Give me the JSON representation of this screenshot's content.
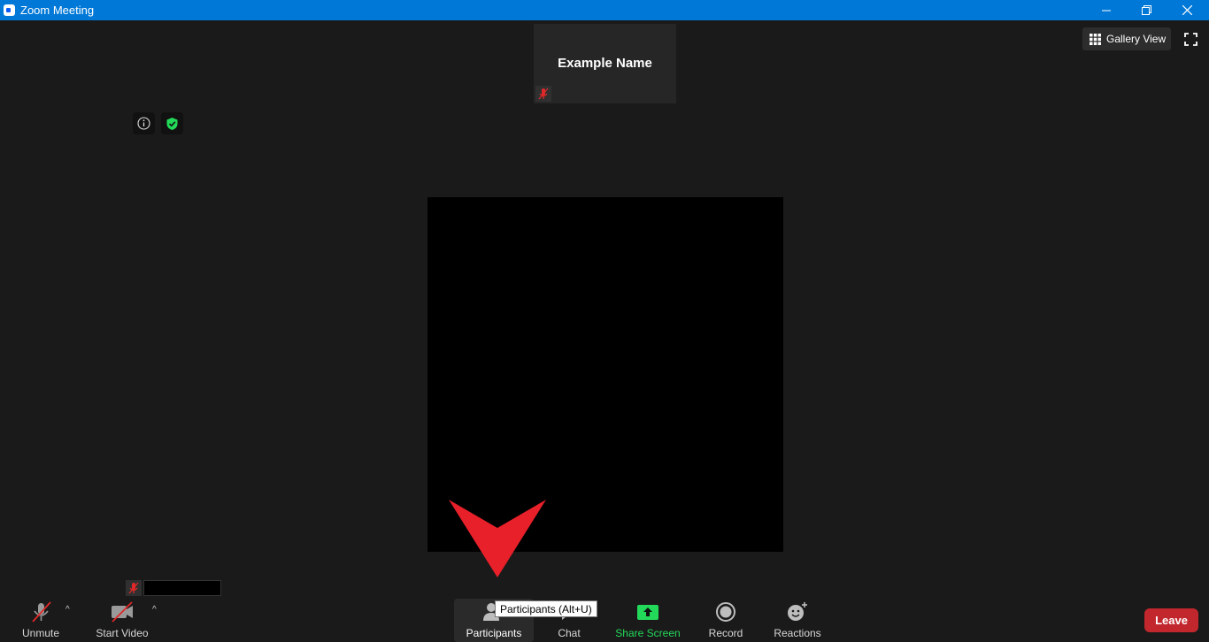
{
  "window": {
    "title": "Zoom Meeting",
    "icon": "zoom-app-icon"
  },
  "top_tile": {
    "name": "Example Name",
    "mic_status_icon": "mic-muted-icon"
  },
  "view": {
    "gallery_label": "Gallery View"
  },
  "toolbar": {
    "unmute_label": "Unmute",
    "start_video_label": "Start Video",
    "participants_label": "Participants",
    "chat_label": "Chat",
    "share_screen_label": "Share Screen",
    "record_label": "Record",
    "reactions_label": "Reactions",
    "leave_label": "Leave"
  },
  "tooltip": {
    "text": "Participants (Alt+U)"
  },
  "colors": {
    "title_bar": "#0078d7",
    "background": "#1a1a1a",
    "share_screen": "#23d959",
    "leave": "#c1272d",
    "annotation_arrow": "#e8202a",
    "muted": "#e02828",
    "secure_shield": "#23d959"
  }
}
